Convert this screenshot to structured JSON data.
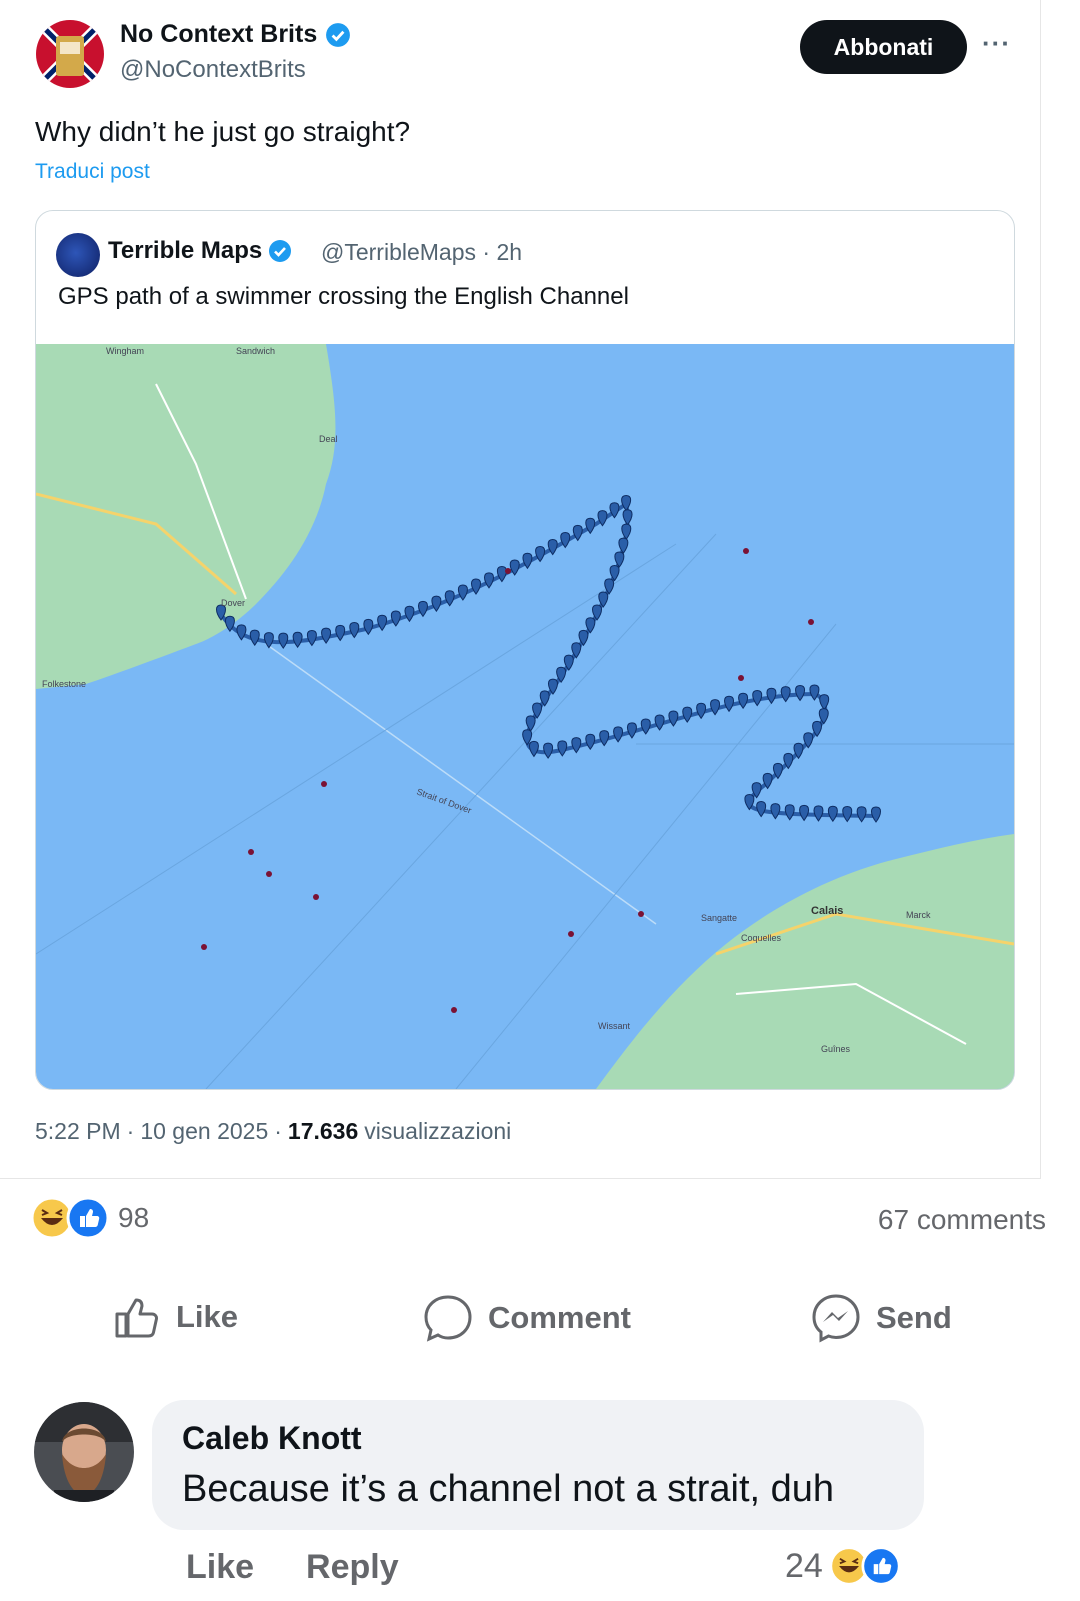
{
  "post": {
    "author_name": "No Context Brits",
    "author_handle": "@NoContextBrits",
    "subscribe_label": "Abbonati",
    "more_label": "···",
    "text": "Why didn’t he just go straight?",
    "translate_label": "Traduci post",
    "time": "5:22 PM",
    "date": "10 gen 2025",
    "views_count": "17.636",
    "views_label": "visualizzazioni",
    "separator": "·"
  },
  "quoted": {
    "author_name": "Terrible Maps",
    "author_handle": "@TerribleMaps · 2h",
    "text": "GPS path of a swimmer crossing the English Channel"
  },
  "map_labels": {
    "calais": "Calais",
    "folkestone": "Folkestone",
    "dover": "Dover",
    "sandwich": "Sandwich",
    "deal": "Deal",
    "wingham": "Wingham",
    "strait": "Strait of Dover",
    "sangatte": "Sangatte",
    "marck": "Marck",
    "coquelles": "Coquelles",
    "guines": "Guînes",
    "wissant": "Wissant"
  },
  "feed": {
    "reaction_count": "98",
    "comments_count": "67 comments",
    "like_label": "Like",
    "comment_label": "Comment",
    "send_label": "Send"
  },
  "comment": {
    "author": "Caleb Knott",
    "text": "Because it’s a channel not a strait, duh",
    "like_label": "Like",
    "reply_label": "Reply",
    "reaction_count": "24"
  },
  "colors": {
    "sea": "#7ab8f5",
    "land": "#a8dab5",
    "marker": "#2a5ea8",
    "twitter_blue": "#1d9bf0",
    "fb_blue": "#1877f2"
  }
}
